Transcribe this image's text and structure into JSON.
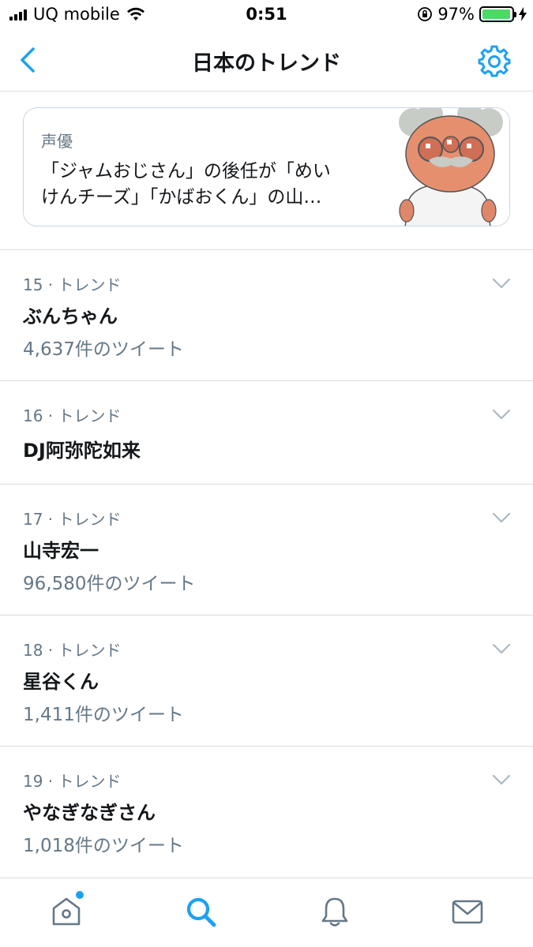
{
  "status_bar": {
    "carrier": "UQ mobile",
    "time": "0:51",
    "battery_percent": "97%",
    "battery_level": 0.97
  },
  "nav": {
    "title": "日本のトレンド",
    "back_icon": "chevron-left-icon",
    "settings_icon": "gear-icon"
  },
  "featured": {
    "category": "声優",
    "headline_line1": "「ジャムおじさん」の後任が「めい",
    "headline_line2": "けんチーズ」「かばおくん」の山…"
  },
  "trends": [
    {
      "meta": "15 · トレンド",
      "name": "ぶんちゃん",
      "count": "4,637件のツイート"
    },
    {
      "meta": "16 · トレンド",
      "name": "DJ阿弥陀如来",
      "count": ""
    },
    {
      "meta": "17 · トレンド",
      "name": "山寺宏一",
      "count": "96,580件のツイート"
    },
    {
      "meta": "18 · トレンド",
      "name": "星谷くん",
      "count": "1,411件のツイート"
    },
    {
      "meta": "19 · トレンド",
      "name": "やなぎなぎさん",
      "count": "1,018件のツイート"
    }
  ],
  "tab_bar": {
    "tabs": [
      "home-icon",
      "search-icon",
      "notifications-bell-icon",
      "messages-envelope-icon"
    ],
    "active_tab": "search-icon",
    "home_has_badge": true
  },
  "colors": {
    "accent": "#1da1f2",
    "secondary_text": "#657786",
    "primary_text": "#14171a",
    "divider": "#d8dee3",
    "battery": "#4cd964"
  }
}
